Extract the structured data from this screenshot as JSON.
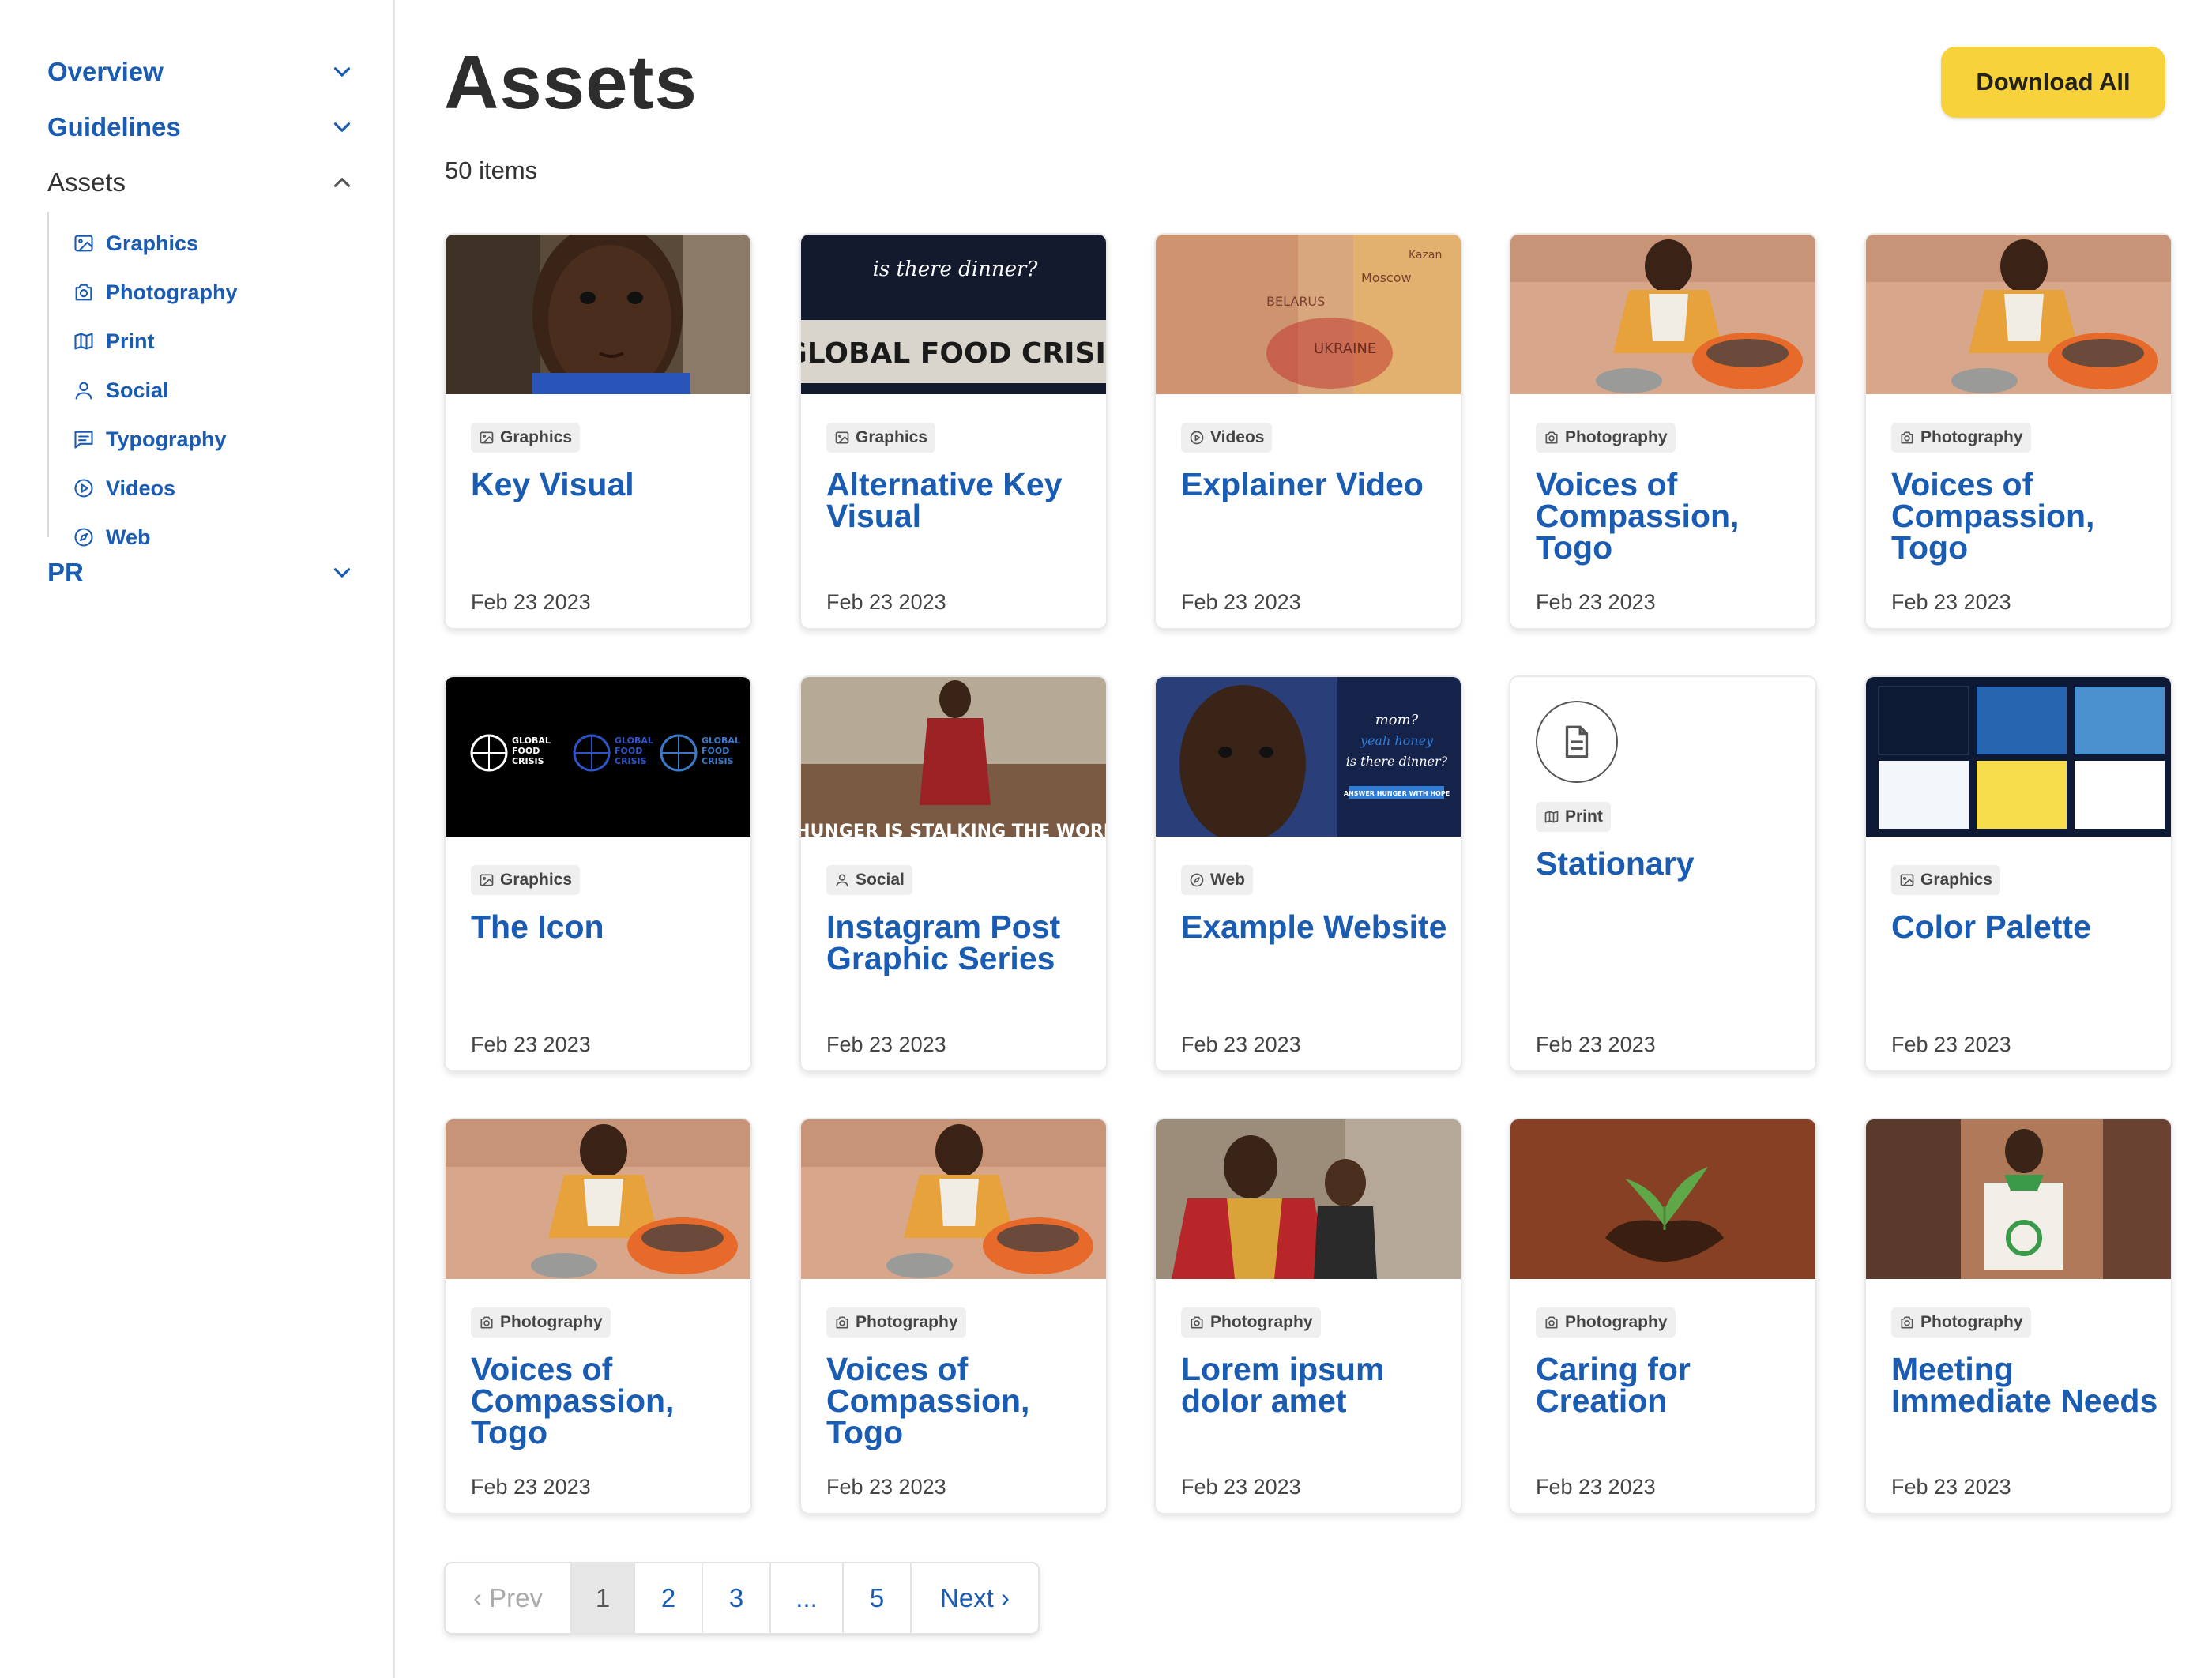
{
  "sidebar": {
    "nav": [
      {
        "label": "Overview"
      },
      {
        "label": "Guidelines"
      },
      {
        "label": "Assets"
      },
      {
        "label": "PR"
      }
    ],
    "sub_items": [
      {
        "label": "Graphics",
        "icon": "image-icon"
      },
      {
        "label": "Photography",
        "icon": "camera-icon"
      },
      {
        "label": "Print",
        "icon": "map-icon"
      },
      {
        "label": "Social",
        "icon": "user-icon"
      },
      {
        "label": "Typography",
        "icon": "message-square-icon"
      },
      {
        "label": "Videos",
        "icon": "play-circle-icon"
      },
      {
        "label": "Web",
        "icon": "compass-icon"
      }
    ]
  },
  "header": {
    "title": "Assets",
    "count": "50 items",
    "download_label": "Download All"
  },
  "cards": [
    {
      "category": "Graphics",
      "title": "Key Visual",
      "date": "Feb 23 2023"
    },
    {
      "category": "Graphics",
      "title": "Alternative Key Visual",
      "date": "Feb 23 2023",
      "thumb_text": [
        "is there dinner?",
        "GLOBAL FOOD CRISIS"
      ]
    },
    {
      "category": "Videos",
      "title": "Explainer Video",
      "date": "Feb 23 2023",
      "thumb_text": [
        "BELARUS",
        "UKRAINE",
        "Moscow",
        "Kazan"
      ]
    },
    {
      "category": "Photography",
      "title": "Voices of Compassion, Togo",
      "date": "Feb 23 2023"
    },
    {
      "category": "Photography",
      "title": "Voices of Compassion, Togo",
      "date": "Feb 23 2023"
    },
    {
      "category": "Graphics",
      "title": "The Icon",
      "date": "Feb 23 2023",
      "thumb_text": [
        "GLOBAL",
        "FOOD",
        "CRISIS"
      ]
    },
    {
      "category": "Social",
      "title": "Instagram Post Graphic Series",
      "date": "Feb 23 2023",
      "thumb_text": [
        "HUNGER IS STALKING THE WORL"
      ]
    },
    {
      "category": "Web",
      "title": "Example Website",
      "date": "Feb 23 2023",
      "thumb_text": [
        "mom?",
        "yeah honey",
        "is there dinner?",
        "ANSWER HUNGER WITH HOPE"
      ]
    },
    {
      "category": "Print",
      "title": "Stationary",
      "date": "Feb 23 2023"
    },
    {
      "category": "Graphics",
      "title": "Color Palette",
      "date": "Feb 23 2023"
    },
    {
      "category": "Photography",
      "title": "Voices of Compassion, Togo",
      "date": "Feb 23 2023"
    },
    {
      "category": "Photography",
      "title": "Voices of Compassion, Togo",
      "date": "Feb 23 2023"
    },
    {
      "category": "Photography",
      "title": "Lorem ipsum dolor amet",
      "date": "Feb 23 2023"
    },
    {
      "category": "Photography",
      "title": "Caring for Creation",
      "date": "Feb 23 2023"
    },
    {
      "category": "Photography",
      "title": "Meeting Immediate Needs",
      "date": "Feb 23 2023"
    }
  ],
  "pagination": {
    "prev": "‹ Prev",
    "pages": [
      "1",
      "2",
      "3",
      "...",
      "5"
    ],
    "current": "1",
    "next": "Next ›"
  },
  "colors": {
    "link_blue": "#1b5cb3",
    "accent_yellow": "#f7d23a",
    "palette_swatches": [
      "#0c1a33",
      "#2865b0",
      "#4a90cf",
      "#f3f6fa",
      "#f7dc4c",
      "#ffffff"
    ]
  }
}
